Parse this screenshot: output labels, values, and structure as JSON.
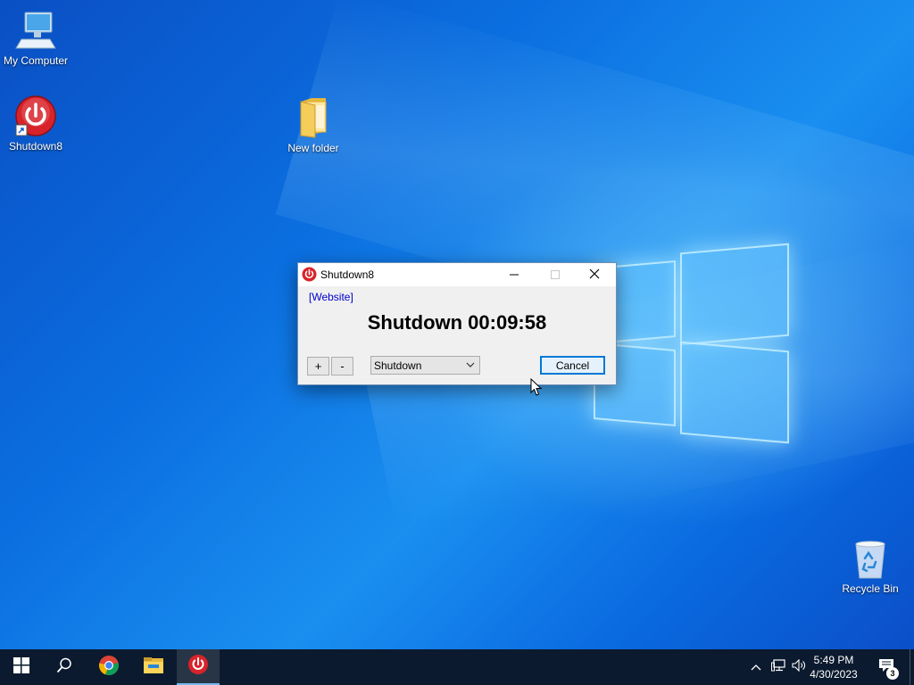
{
  "desktop": {
    "icons": [
      {
        "label": "My Computer"
      },
      {
        "label": "Shutdown8"
      },
      {
        "label": "New folder"
      },
      {
        "label": "Recycle Bin"
      }
    ]
  },
  "dialog": {
    "title": "Shutdown8",
    "website_link": "[Website]",
    "countdown": "Shutdown 00:09:58",
    "plus_label": "+",
    "minus_label": "-",
    "action_select": {
      "selected": "Shutdown"
    },
    "cancel_label": "Cancel"
  },
  "taskbar": {
    "apps": [
      "start-icon",
      "search-icon",
      "chrome-icon",
      "file-explorer-icon",
      "shutdown8-icon"
    ],
    "clock": {
      "time": "5:49 PM",
      "date": "4/30/2023"
    },
    "notification_count": "3"
  },
  "colors": {
    "accent": "#0078d7",
    "taskbar_bg": "#0b1a2e",
    "power_red": "#d8232a"
  }
}
